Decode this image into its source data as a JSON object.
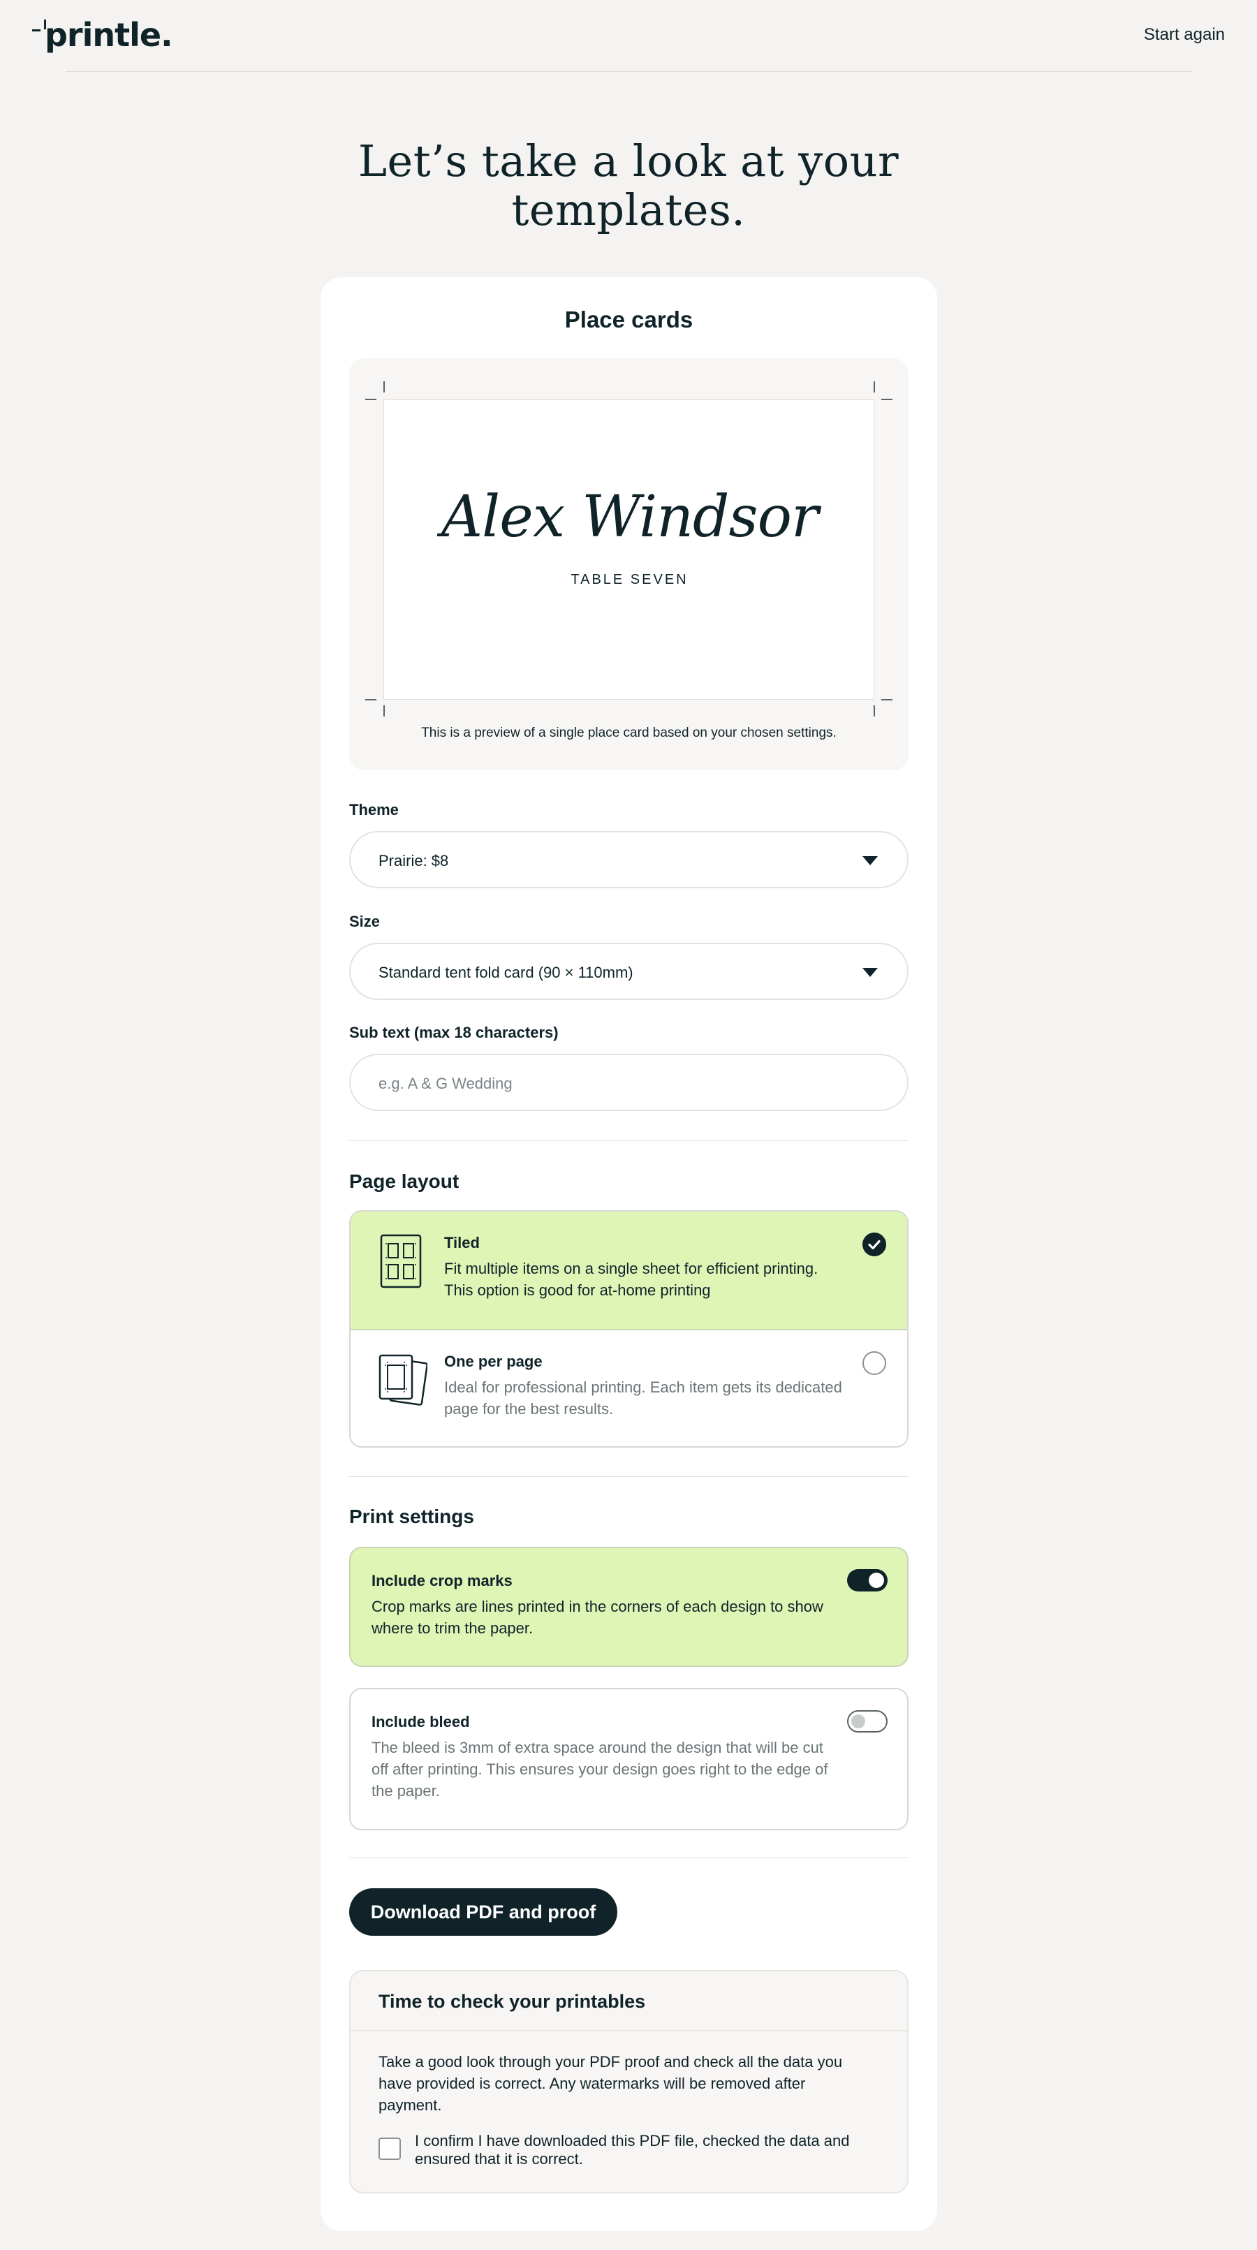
{
  "header": {
    "logo": "printle.",
    "start_again": "Start again"
  },
  "headline": {
    "line1": "Let’s take a look at your",
    "line2": "templates."
  },
  "card": {
    "title": "Place cards",
    "preview": {
      "guest_name": "Alex Windsor",
      "sub_line": "TABLE SEVEN",
      "caption": "This is a preview of a single place card based on your chosen settings."
    },
    "theme": {
      "label": "Theme",
      "value": "Prairie: $8"
    },
    "size": {
      "label": "Size",
      "value": "Standard tent fold card (90 × 110mm)"
    },
    "subtext": {
      "label": "Sub text (max 18 characters)",
      "placeholder": "e.g. A & G Wedding"
    },
    "page_layout": {
      "title": "Page layout",
      "options": [
        {
          "title": "Tiled",
          "desc_line1": "Fit multiple items on a single sheet for efficient printing.",
          "desc_line2": "This option is good for at-home printing",
          "selected": true
        },
        {
          "title": "One per page",
          "desc_line1": "Ideal for professional printing. Each item gets its dedicated",
          "desc_line2": "page for the best results.",
          "selected": false
        }
      ]
    },
    "print_settings": {
      "title": "Print settings",
      "crop_marks": {
        "title": "Include crop marks",
        "desc_line1": "Crop marks are lines printed in the corners of each design to show",
        "desc_line2": "where to trim the paper.",
        "enabled": true
      },
      "bleed": {
        "title": "Include bleed",
        "desc_line1": "The bleed is 3mm of extra space around the design that will be cut",
        "desc_line2": "off after printing. This ensures your design goes right to the edge of",
        "desc_line3": "the paper.",
        "enabled": false
      }
    },
    "download_button": "Download PDF and proof",
    "check": {
      "title": "Time to check your printables",
      "body_line1": "Take a good look through your PDF proof and check all the data you",
      "body_line2": "have provided is correct. Any watermarks will be removed after",
      "body_line3": "payment.",
      "confirm_line1": "I confirm I have downloaded this PDF file, checked the data and",
      "confirm_line2": "ensured that it is correct."
    }
  },
  "colors": {
    "ink": "#0f2329",
    "background": "#f4f3f1",
    "selected_green": "#def5b6"
  }
}
